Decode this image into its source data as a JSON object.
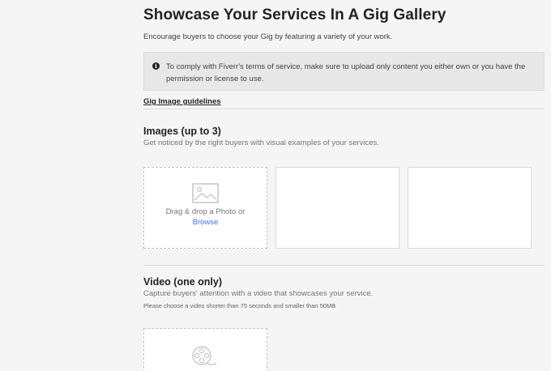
{
  "gallery": {
    "title": "Showcase Your Services In A Gig Gallery",
    "subtitle": "Encourage buyers to choose your Gig by featuring a variety of your work.",
    "notice": {
      "icon": "info-icon",
      "text": "To comply with Fiverr's terms of service, make sure to upload only content you either own or you have the permission or license to use."
    },
    "guidelines_link": "Gig Image guidelines"
  },
  "images": {
    "title": "Images (up to 3)",
    "subtitle": "Get noticed by the right buyers with visual examples of your services.",
    "upload": {
      "icon": "photo-icon",
      "drop_text": "Drag & drop a Photo or",
      "browse_label": "Browse"
    }
  },
  "video": {
    "title": "Video (one only)",
    "subtitle": "Capture buyers' attention with a video that showcases your service.",
    "note": "Please choose a video shorter than 75 seconds and smaller than 50MB",
    "upload": {
      "icon": "video-reel-icon"
    }
  },
  "colors": {
    "background": "#f5f5f5",
    "notice_bg": "#e8e8e8",
    "link": "#446ee7",
    "heading": "#222325"
  }
}
